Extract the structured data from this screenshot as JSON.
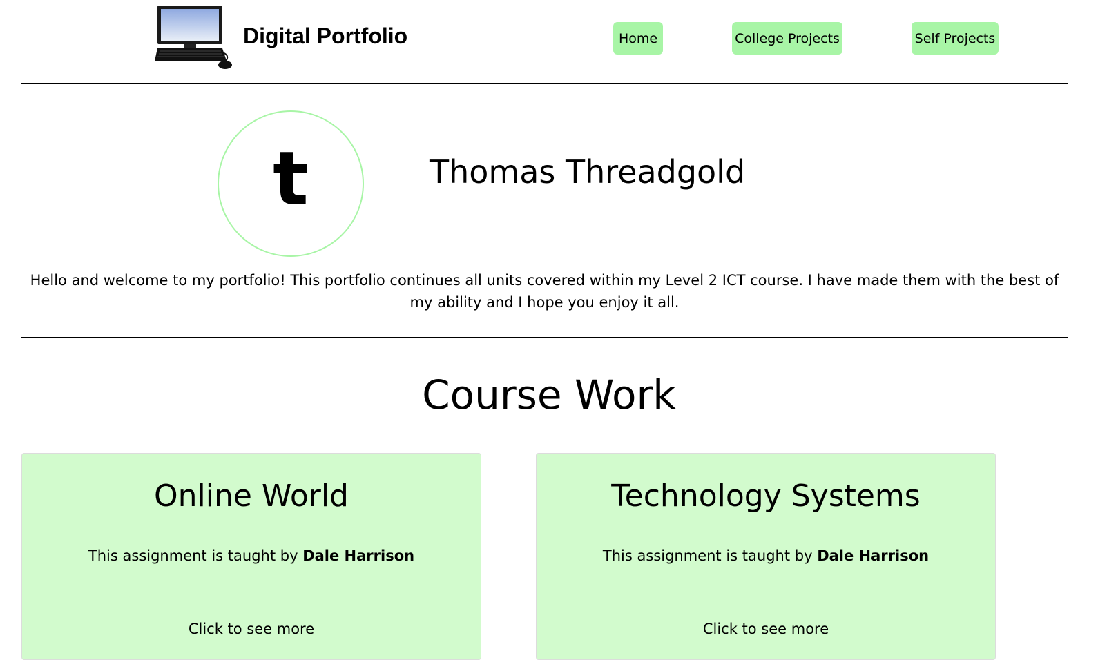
{
  "header": {
    "brand": "Digital Portfolio",
    "logo_icon": "desktop-computer-icon",
    "nav": [
      {
        "label": "Home"
      },
      {
        "label": "College Projects"
      },
      {
        "label": "Self Projects"
      }
    ]
  },
  "profile": {
    "avatar_letter": "t",
    "name": "Thomas Threadgold",
    "intro": "Hello and welcome to my portfolio! This portfolio continues all units covered within my Level 2 ICT course. I have made them with the best of my ability and I hope you enjoy it all."
  },
  "course_work": {
    "title": "Course Work",
    "cards": [
      {
        "title": "Online World",
        "teacher_prefix": "This assignment is taught by",
        "teacher": "Dale Harrison",
        "more": "Click to see more"
      },
      {
        "title": "Technology Systems",
        "teacher_prefix": "This assignment is taught by",
        "teacher": "Dale Harrison",
        "more": "Click to see more"
      }
    ]
  },
  "colors": {
    "accent_green": "#a8f5a6",
    "card_green": "#d2fbcd",
    "rule": "#000000"
  }
}
